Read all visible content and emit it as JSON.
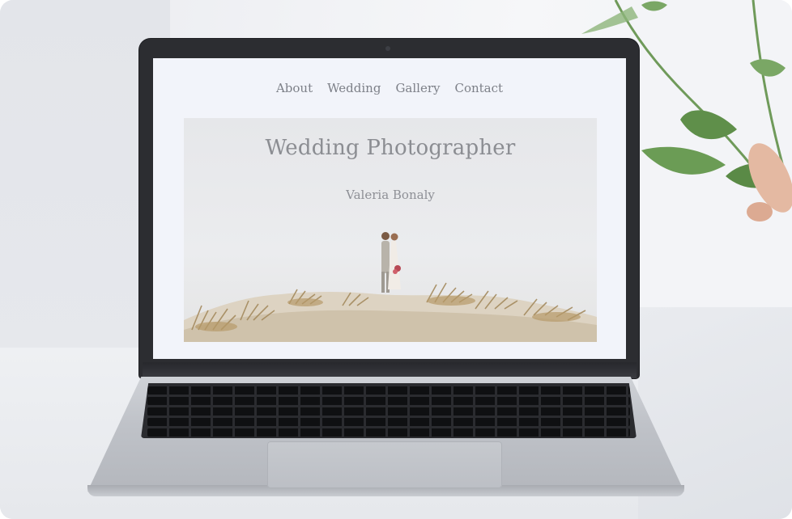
{
  "site": {
    "nav": {
      "items": [
        {
          "label": "About"
        },
        {
          "label": "Wedding"
        },
        {
          "label": "Gallery"
        },
        {
          "label": "Contact"
        }
      ]
    },
    "hero": {
      "title": "Wedding Photographer",
      "subtitle": "Valeria Bonaly"
    }
  },
  "colors": {
    "screen_background": "#f2f4fa",
    "nav_text": "#7d8088",
    "hero_text": "#8b8d92",
    "laptop_bezel": "#2c2d31"
  },
  "icons": {
    "hero_image": "couple-on-dunes-photo",
    "decor": "plant-leaves"
  }
}
